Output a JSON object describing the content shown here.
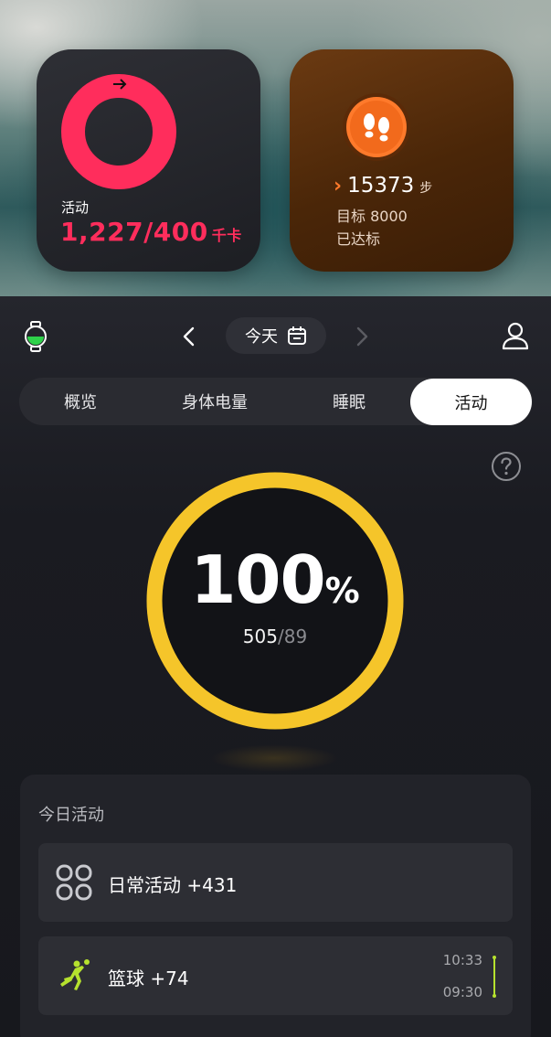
{
  "widgets": {
    "activity": {
      "label": "活动",
      "value": "1,227/400",
      "unit": "千卡",
      "progress": 1.0,
      "ring_color": "#ff2d5c"
    },
    "steps": {
      "arrow": "›",
      "count": "15373",
      "unit": "步",
      "goal": "目标 8000",
      "status": "已达标",
      "badge_icon": "footprints-icon",
      "accent": "#ff7a2b"
    }
  },
  "header": {
    "date_label": "今天",
    "prev_icon": "chevron-left-icon",
    "next_icon": "chevron-right-icon",
    "calendar_icon": "calendar-icon",
    "device_icon": "watch-icon",
    "profile_icon": "person-icon"
  },
  "tabs": [
    {
      "label": "概览",
      "active": false
    },
    {
      "label": "身体电量",
      "active": false
    },
    {
      "label": "睡眠",
      "active": false
    },
    {
      "label": "活动",
      "active": true
    }
  ],
  "summary": {
    "percent": "100",
    "percent_sign": "%",
    "current": "505",
    "separator": "/",
    "goal": "89",
    "progress": 1.0,
    "ring_color": "#f5c52a"
  },
  "today": {
    "title": "今日活动",
    "items": [
      {
        "label": "日常活动 +431",
        "icon": "grid-four-icon"
      },
      {
        "label": "篮球 +74",
        "icon": "basketball-player-icon",
        "time_end": "10:33",
        "time_start": "09:30",
        "accent": "#b6e22e"
      }
    ]
  }
}
